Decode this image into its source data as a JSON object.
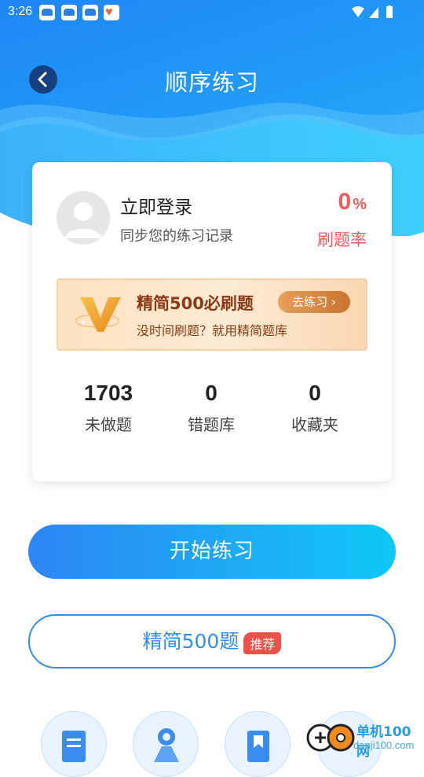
{
  "status_bar": {
    "time": "3:26"
  },
  "header": {
    "title": "顺序练习"
  },
  "card": {
    "login_title": "立即登录",
    "login_subtitle": "同步您的练习记录",
    "rate_value": "0",
    "rate_unit": "%",
    "rate_label": "刷题率",
    "promo": {
      "title": "精简500必刷题",
      "subtitle": "没时间刷题？就用精简题库",
      "button": "去练习 ›"
    },
    "stats": [
      {
        "value": "1703",
        "label": "未做题"
      },
      {
        "value": "0",
        "label": "错题库"
      },
      {
        "value": "0",
        "label": "收藏夹"
      }
    ]
  },
  "actions": {
    "start_label": "开始练习",
    "simple_label": "精简500题",
    "simple_badge": "推荐"
  },
  "watermark": {
    "text": "单机100网",
    "sub": "danji100.com"
  },
  "colors": {
    "primary_blue": "#2e8ef2",
    "accent_red": "#f05a5a",
    "promo_brown": "#8a3b15"
  }
}
